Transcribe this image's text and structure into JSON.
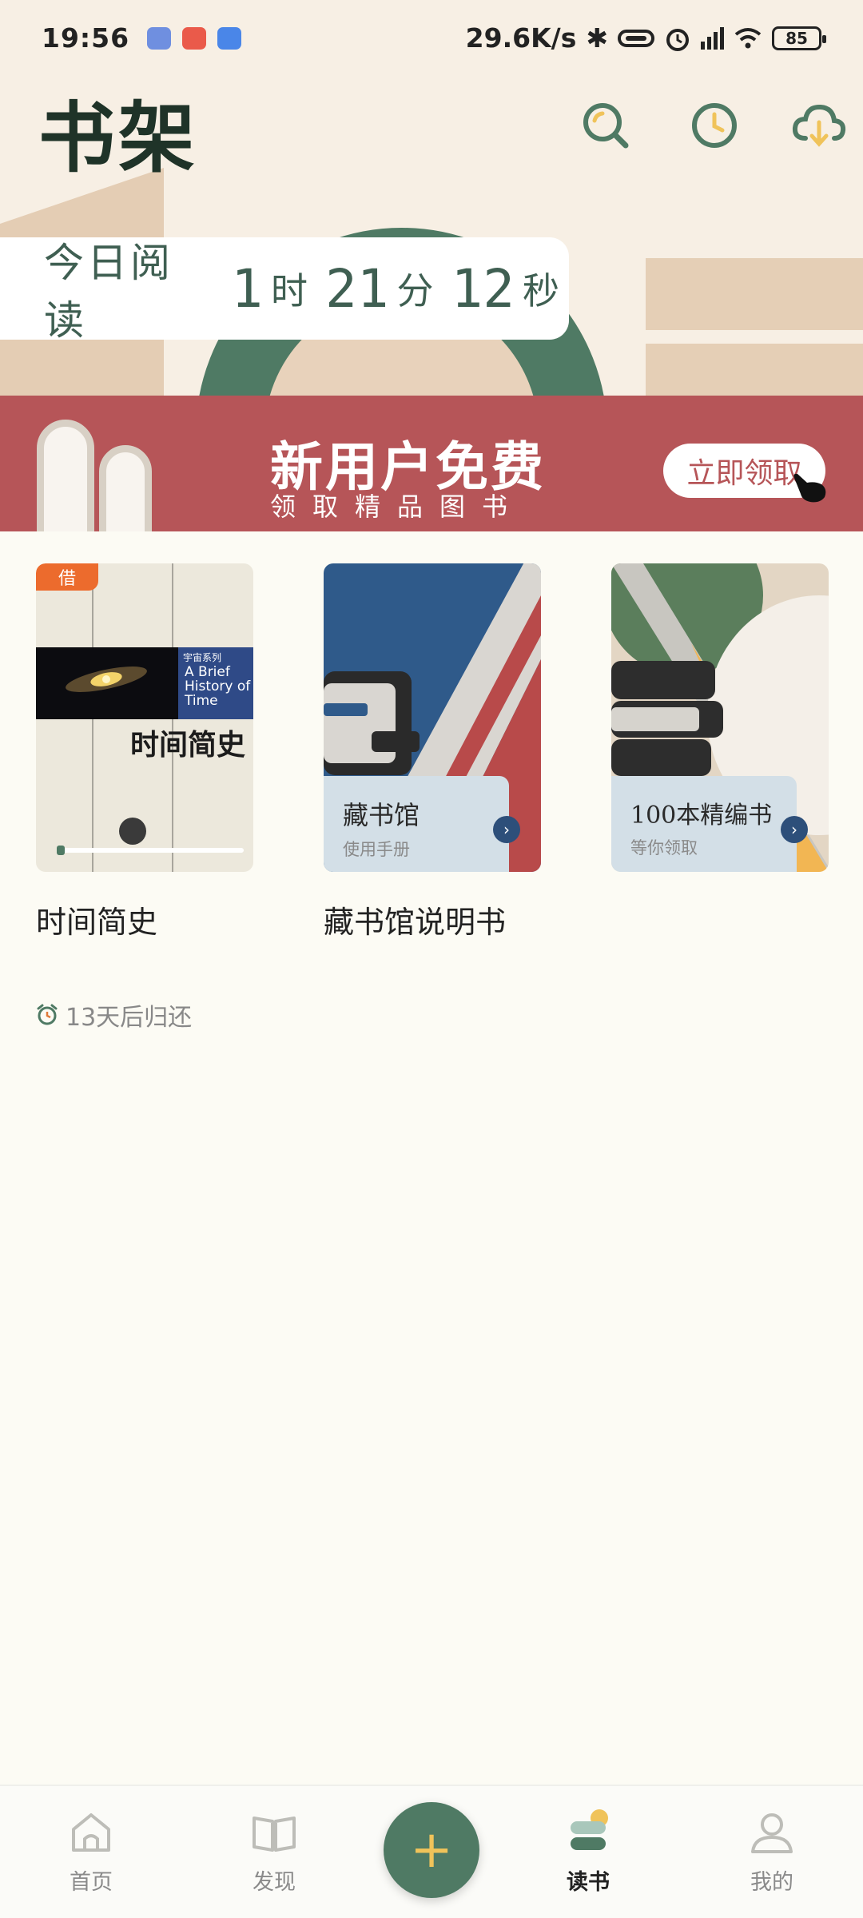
{
  "status_bar": {
    "time": "19:56",
    "network_speed": "29.6K/s",
    "battery": "85",
    "notification_icons": [
      "chat-app-icon",
      "health-app-icon",
      "assistant-app-icon"
    ]
  },
  "header": {
    "title": "书架",
    "actions": [
      "search-icon",
      "history-clock-icon",
      "cloud-download-icon"
    ]
  },
  "reading_today": {
    "label": "今日阅读",
    "hours": "1",
    "hours_unit": "时",
    "minutes": "21",
    "minutes_unit": "分",
    "seconds": "12",
    "seconds_unit": "秒"
  },
  "promo": {
    "title": "新用户免费",
    "subtitle": "领取精品图书",
    "button": "立即领取"
  },
  "books": [
    {
      "title": "时间简史",
      "badge": "借",
      "cover_series": "宇宙系列",
      "cover_en": "A Brief History of Time",
      "cover_cn": "时间简史"
    },
    {
      "title": "藏书馆说明书",
      "cover_title": "藏书馆",
      "cover_sub": "使用手册"
    },
    {
      "cover_title": "100本精编书",
      "cover_sub": "等你领取"
    }
  ],
  "due_notice": "13天后归还",
  "bottom_nav": {
    "home": "首页",
    "discover": "发现",
    "fab": "+",
    "read": "读书",
    "mine": "我的"
  },
  "colors": {
    "accent_green": "#4f7a64",
    "promo_red": "#b65558",
    "borrow_orange": "#ec6b2d",
    "fab_plus": "#f0c35a"
  }
}
